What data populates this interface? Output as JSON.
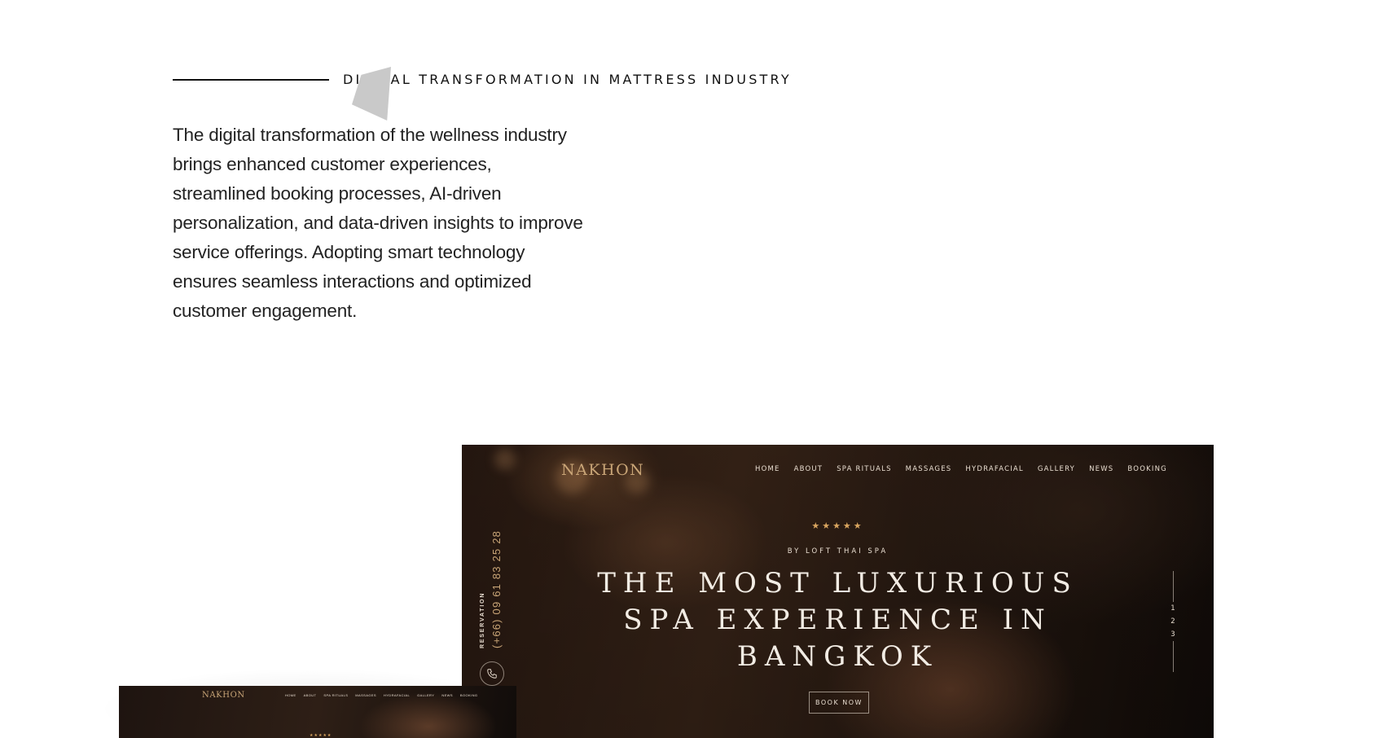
{
  "section": {
    "eyebrow": "DIGITAL TRANSFORMATION IN MATTRESS INDUSTRY",
    "body": "The digital transformation of the wellness industry brings enhanced customer experiences, streamlined booking processes, AI-driven personalization, and data-driven insights to improve service offerings. Adopting smart technology ensures seamless interactions and optimized customer engagement."
  },
  "hero": {
    "logo": "NAKHON",
    "nav": [
      "HOME",
      "ABOUT",
      "SPA RITUALS",
      "MASSAGES",
      "HYDRAFACIAL",
      "GALLERY",
      "NEWS",
      "BOOKING"
    ],
    "stars": "★★★★★",
    "by_line": "BY LOFT THAI SPA",
    "title_lines": [
      "THE MOST LUXURIOUS",
      "SPA EXPERIENCE IN",
      "BANGKOK"
    ],
    "cta": "BOOK NOW",
    "reservation_label": "RESERVATION",
    "phone": "(+66) 09 61 83 25 28",
    "pager": [
      "1",
      "2",
      "3"
    ]
  },
  "mini": {
    "logo": "NAKHON",
    "nav": [
      "HOME",
      "ABOUT",
      "SPA RITUALS",
      "MASSAGES",
      "HYDRAFACIAL",
      "GALLERY",
      "NEWS",
      "BOOKING"
    ],
    "stars": "★★★★★"
  },
  "colors": {
    "accent_gold": "#c9a577",
    "star_gold": "#d9a55f",
    "text_dark": "#111111"
  }
}
